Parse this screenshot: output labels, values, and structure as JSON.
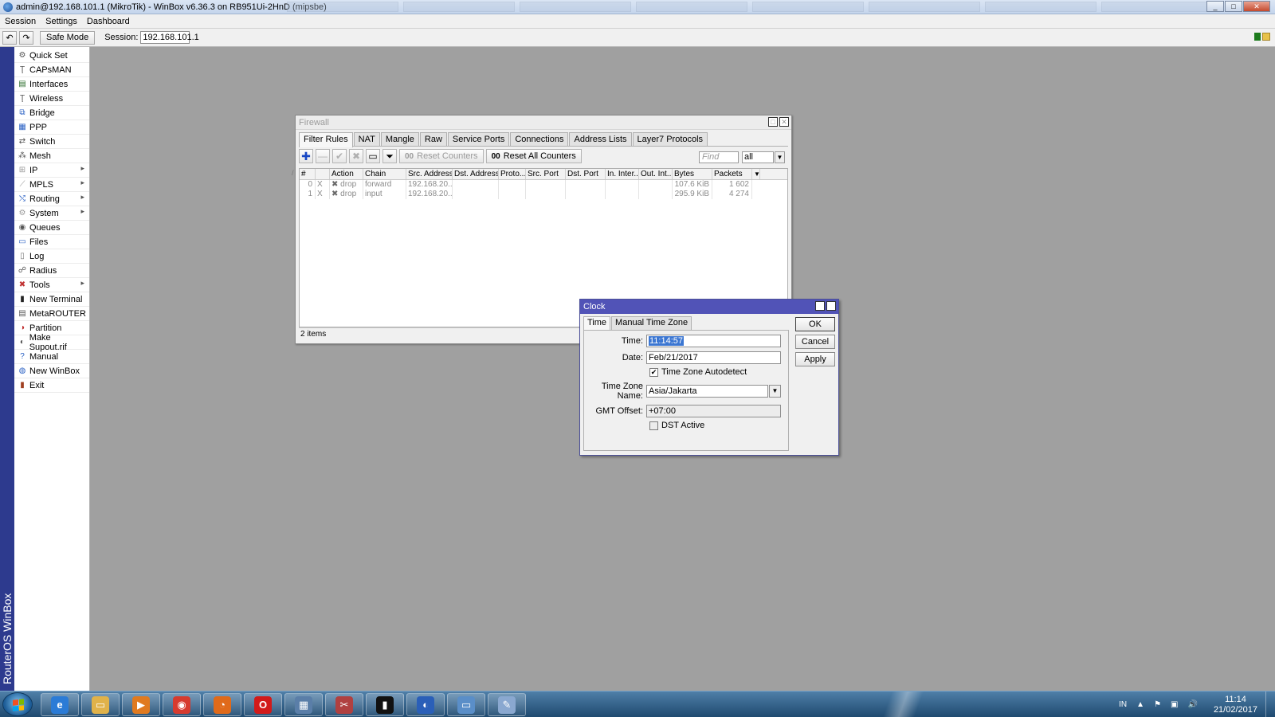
{
  "window": {
    "title": "admin@192.168.101.1 (MikroTik) - WinBox v6.36.3 on RB951Ui-2HnD (mipsbe)"
  },
  "menubar": [
    "Session",
    "Settings",
    "Dashboard"
  ],
  "toolbar": {
    "safe_mode": "Safe Mode",
    "session_label": "Session:",
    "session_value": "192.168.101.1"
  },
  "brand_strip": "RouterOS WinBox",
  "sidemenu": [
    {
      "label": "Quick Set",
      "icon": "quickset-icon",
      "sub": false
    },
    {
      "label": "CAPsMAN",
      "icon": "capsman-icon",
      "sub": false
    },
    {
      "label": "Interfaces",
      "icon": "interfaces-icon",
      "sub": false
    },
    {
      "label": "Wireless",
      "icon": "wireless-icon",
      "sub": false
    },
    {
      "label": "Bridge",
      "icon": "bridge-icon",
      "sub": false
    },
    {
      "label": "PPP",
      "icon": "ppp-icon",
      "sub": false
    },
    {
      "label": "Switch",
      "icon": "switch-icon",
      "sub": false
    },
    {
      "label": "Mesh",
      "icon": "mesh-icon",
      "sub": false
    },
    {
      "label": "IP",
      "icon": "ip-icon",
      "sub": true
    },
    {
      "label": "MPLS",
      "icon": "mpls-icon",
      "sub": true
    },
    {
      "label": "Routing",
      "icon": "routing-icon",
      "sub": true
    },
    {
      "label": "System",
      "icon": "system-icon",
      "sub": true
    },
    {
      "label": "Queues",
      "icon": "queues-icon",
      "sub": false
    },
    {
      "label": "Files",
      "icon": "files-icon",
      "sub": false
    },
    {
      "label": "Log",
      "icon": "log-icon",
      "sub": false
    },
    {
      "label": "Radius",
      "icon": "radius-icon",
      "sub": false
    },
    {
      "label": "Tools",
      "icon": "tools-icon",
      "sub": true
    },
    {
      "label": "New Terminal",
      "icon": "terminal-icon",
      "sub": false
    },
    {
      "label": "MetaROUTER",
      "icon": "metarouter-icon",
      "sub": false
    },
    {
      "label": "Partition",
      "icon": "partition-icon",
      "sub": false
    },
    {
      "label": "Make Supout.rif",
      "icon": "supout-icon",
      "sub": false
    },
    {
      "label": "Manual",
      "icon": "manual-icon",
      "sub": false
    },
    {
      "label": "New WinBox",
      "icon": "winbox-icon",
      "sub": false
    },
    {
      "label": "Exit",
      "icon": "exit-icon",
      "sub": false
    }
  ],
  "firewall": {
    "title": "Firewall",
    "tabs": [
      "Filter Rules",
      "NAT",
      "Mangle",
      "Raw",
      "Service Ports",
      "Connections",
      "Address Lists",
      "Layer7 Protocols"
    ],
    "active_tab": "Filter Rules",
    "reset_counters": "Reset Counters",
    "reset_all_counters": "Reset All Counters",
    "counter_glyph": "00",
    "find_placeholder": "Find",
    "filter_value": "all",
    "columns": [
      "#",
      "",
      "Action",
      "Chain",
      "Src. Address",
      "Dst. Address",
      "Proto...",
      "Src. Port",
      "Dst. Port",
      "In. Inter...",
      "Out. Int...",
      "Bytes",
      "Packets"
    ],
    "sort_indicator": "/",
    "rows": [
      {
        "num": "0",
        "flag": "X",
        "action": "drop",
        "chain": "forward",
        "src": "192.168.20...",
        "bytes": "107.6 KiB",
        "packets": "1 602"
      },
      {
        "num": "1",
        "flag": "X",
        "action": "drop",
        "chain": "input",
        "src": "192.168.20...",
        "bytes": "295.9 KiB",
        "packets": "4 274"
      }
    ],
    "status": "2 items"
  },
  "clock": {
    "title": "Clock",
    "tabs": [
      "Time",
      "Manual Time Zone"
    ],
    "active_tab": "Time",
    "time_label": "Time:",
    "time_value": "11:14:57",
    "date_label": "Date:",
    "date_value": "Feb/21/2017",
    "autodetect_label": "Time Zone Autodetect",
    "autodetect_checked": true,
    "tz_label": "Time Zone Name:",
    "tz_value": "Asia/Jakarta",
    "gmt_label": "GMT Offset:",
    "gmt_value": "+07:00",
    "dst_label": "DST Active",
    "dst_checked": false,
    "buttons": [
      "OK",
      "Cancel",
      "Apply"
    ]
  },
  "taskbar": {
    "apps": [
      "internet-explorer-icon",
      "file-explorer-icon",
      "media-player-icon",
      "chrome-icon",
      "firefox-icon",
      "opera-icon",
      "network-app-icon",
      "snipping-tool-icon",
      "command-prompt-icon",
      "browser-app-icon",
      "window-app-icon",
      "paint-icon"
    ],
    "lang": "IN",
    "time": "11:14",
    "date": "21/02/2017"
  },
  "colors": {
    "strip": "#2d3a8e",
    "dialog_title": "#5153b7",
    "selection": "#3b76d2",
    "desktop": "#a0a0a0"
  }
}
